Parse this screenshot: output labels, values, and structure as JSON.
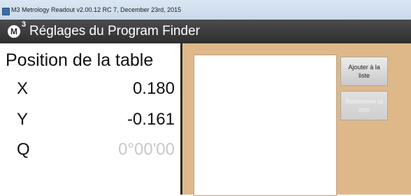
{
  "window": {
    "title": "M3 Metrology Readout  v2.00.12 RC 7, December 23rd, 2015"
  },
  "header": {
    "logo": "M",
    "logo_sup": "3",
    "title": "Réglages du Program Finder"
  },
  "readout": {
    "title": "Position de la table",
    "axes": [
      {
        "label": "X",
        "value": "0.180",
        "dimmed": false
      },
      {
        "label": "Y",
        "value": "-0.161",
        "dimmed": false
      },
      {
        "label": "Q",
        "value": "0°00'00",
        "dimmed": true
      }
    ]
  },
  "panel": {
    "add_button": "Ajouter à la liste",
    "rename_button": "Renommer la liste"
  },
  "colors": {
    "panel_bg": "#dfb88a",
    "header_bg": "#3a3a3a"
  }
}
